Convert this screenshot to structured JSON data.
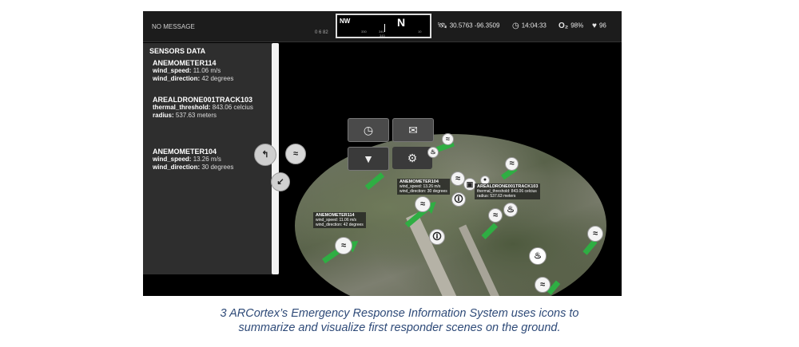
{
  "topbar": {
    "message": "NO MESSAGE",
    "message_number": "0 6 82",
    "compass": {
      "left_label": "NW",
      "center_label": "N",
      "ticks": [
        "330",
        "340",
        "345",
        "10"
      ]
    },
    "coords": "30.5763 -96.3509",
    "time": "14:04:33",
    "oxygen": "98%",
    "heart": "96"
  },
  "sidebar": {
    "title": "SENSORS DATA",
    "sensors": [
      {
        "name": "ANEMOMETER114",
        "line1_key": "wind_speed:",
        "line1_val": "11.06 m/s",
        "line2_key": "wind_direction:",
        "line2_val": "42 degrees"
      },
      {
        "name": "AREALDRONE001TRACK103",
        "line1_key": "thermal_threshold:",
        "line1_val": "843.06 celcius",
        "line2_key": "radius:",
        "line2_val": "537.63 meters"
      },
      {
        "name": "ANEMOMETER104",
        "line1_key": "wind_speed:",
        "line1_val": "13.26 m/s",
        "line2_key": "wind_direction:",
        "line2_val": "30 degrees"
      }
    ]
  },
  "map_labels": [
    {
      "name": "ANEMOMETER114",
      "l1": "wind_speed: 11.06 m/s",
      "l2": "wind_direction: 42 degrees"
    },
    {
      "name": "ANEMOMETER104",
      "l1": "wind_speed: 13.26 m/s",
      "l2": "wind_direction: 30 degrees"
    },
    {
      "name": "AREALDRONE001TRACK103",
      "l1": "thermal_threshold: 843.06 celcius",
      "l2": "radius: 537.63 meters"
    }
  ],
  "icons": {
    "status": "person-icon",
    "wind": "wind-icon",
    "fire": "fire-icon",
    "drone": "cube-icon",
    "settings": "gear-icon",
    "filter": "filter-icon",
    "mail": "mail-icon",
    "clock": "clock-icon"
  },
  "colors": {
    "wind_arrow": "#2fae43",
    "caption": "#2e4a78"
  },
  "caption": {
    "line1": "3 ARCortex’s Emergency Response Information System uses icons to",
    "line2": "summarize and visualize first responder scenes on the ground."
  }
}
